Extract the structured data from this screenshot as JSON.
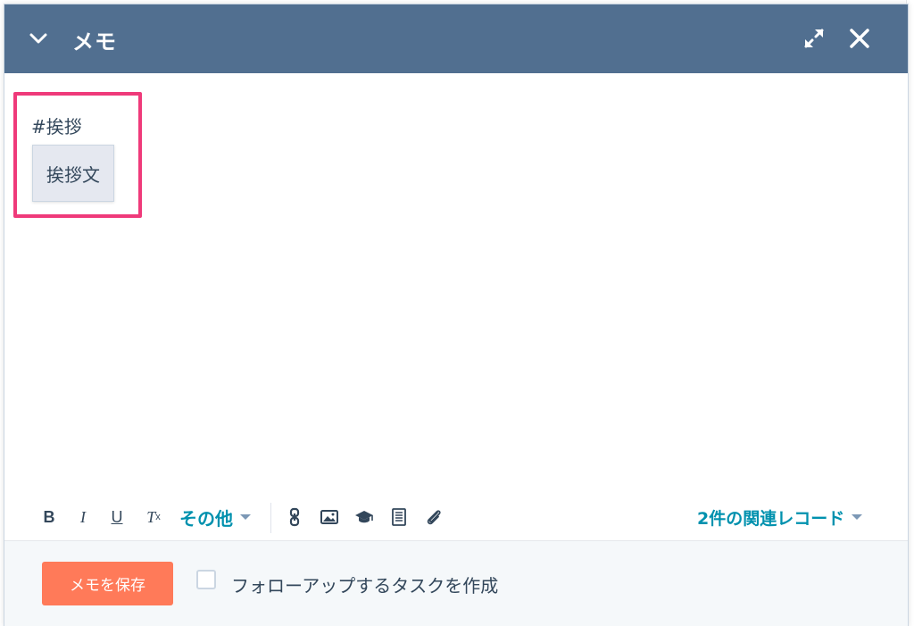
{
  "modal": {
    "title": "メモ"
  },
  "editor": {
    "content_text": "#挨拶",
    "suggestion": "挨拶文"
  },
  "toolbar": {
    "bold_label": "B",
    "italic_label": "I",
    "underline_label": "U",
    "clear_format_label": "T",
    "clear_format_sub": "x",
    "more_label": "その他",
    "related_records_label": "2件の関連レコード"
  },
  "footer": {
    "save_label": "メモを保存",
    "followup_task_label": "フォローアップするタスクを作成",
    "followup_checked": false
  },
  "colors": {
    "header_bg": "#516f90",
    "accent_link": "#0091ae",
    "primary_button": "#ff7a59",
    "highlight_border": "#ef3a7a"
  },
  "icons": {
    "collapse": "chevron-down-icon",
    "expand": "expand-icon",
    "close": "close-icon",
    "link": "link-icon",
    "image": "image-icon",
    "knowledge": "graduation-cap-icon",
    "snippet": "document-icon",
    "attach": "paperclip-icon"
  }
}
